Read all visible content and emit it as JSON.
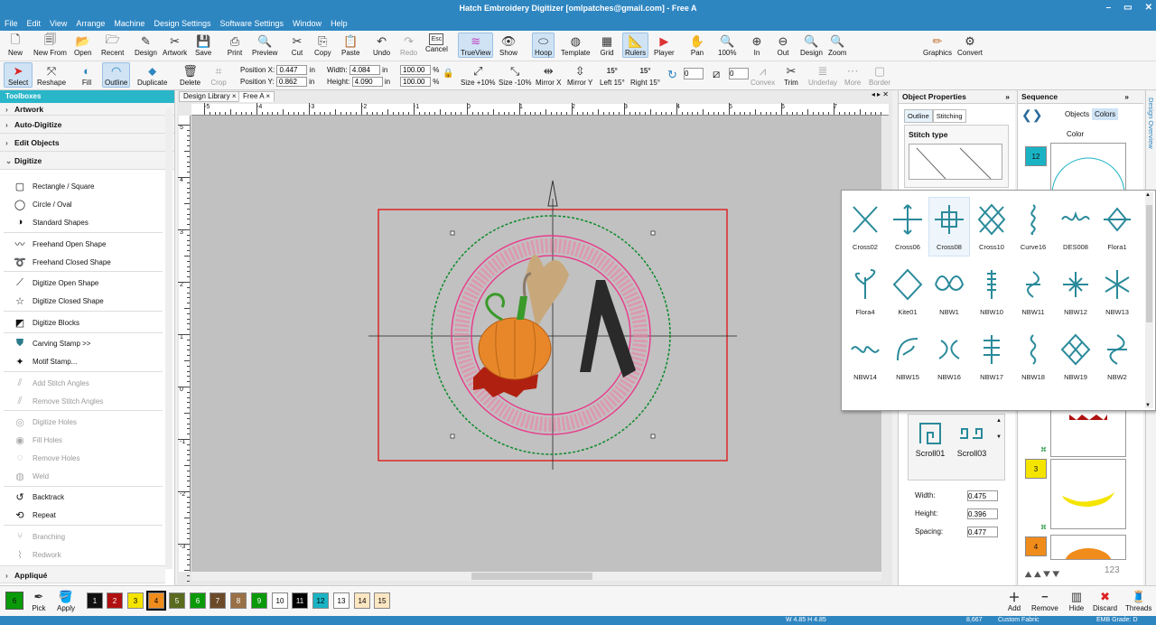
{
  "window": {
    "title": "Hatch Embroidery Digitizer [omlpatches@gmail.com] - Free A",
    "min": "–",
    "max": "▭",
    "close": "✕"
  },
  "menu": [
    "File",
    "Edit",
    "View",
    "Arrange",
    "Machine",
    "Design Settings",
    "Software Settings",
    "Window",
    "Help"
  ],
  "toolbar1": {
    "new": "New",
    "new_from": "New From",
    "open": "Open",
    "recent": "Recent",
    "design": "Design",
    "artwork": "Artwork",
    "save": "Save",
    "print": "Print",
    "preview": "Preview",
    "cut": "Cut",
    "copy": "Copy",
    "paste": "Paste",
    "undo": "Undo",
    "redo": "Redo",
    "cancel": "Cancel",
    "esc": "Esc",
    "trueview": "TrueView",
    "show": "Show",
    "hoop": "Hoop",
    "template": "Template",
    "grid": "Grid",
    "rulers": "Rulers",
    "player": "Player",
    "pan": "Pan",
    "zoom100": "100%",
    "in": "In",
    "out": "Out",
    "zdesign": "Design",
    "zoom": "Zoom",
    "zoom_value": "100",
    "percent": "%",
    "graphics": "Graphics",
    "convert": "Convert"
  },
  "toolbar2": {
    "select": "Select",
    "reshape": "Reshape",
    "fill": "Fill",
    "outline": "Outline",
    "duplicate": "Duplicate",
    "delete": "Delete",
    "crop": "Crop",
    "posx_label": "Position X:",
    "posx": "0.447",
    "posy_label": "Position Y:",
    "posy": "0.862",
    "unit": "in",
    "width_label": "Width:",
    "width": "4.084",
    "height_label": "Height:",
    "height": "4.090",
    "scale_w": "100.00",
    "scale_h": "100.00",
    "pct": "%",
    "size_up": "Size +10%",
    "size_down": "Size -10%",
    "mirror_x": "Mirror X",
    "mirror_y": "Mirror Y",
    "left15": "Left 15°",
    "right15": "Right 15°",
    "deg15": "15°",
    "rot_val": "0",
    "slant_val": "0",
    "convex": "Convex",
    "trim": "Trim",
    "underlay": "Underlay",
    "more": "More",
    "border": "Border"
  },
  "toolbox": {
    "title": "Toolboxes",
    "groups": [
      "Artwork",
      "Auto-Digitize",
      "Edit Objects",
      "Digitize",
      "Appliqué"
    ],
    "items": [
      "Rectangle / Square",
      "Circle / Oval",
      "Standard Shapes",
      "Freehand Open Shape",
      "Freehand Closed Shape",
      "Digitize Open Shape",
      "Digitize Closed Shape",
      "Digitize Blocks",
      "Carving Stamp >>",
      "Motif Stamp...",
      "Add Stitch Angles",
      "Remove Stitch Angles",
      "Digitize Holes",
      "Fill Holes",
      "Remove Holes",
      "Weld",
      "Backtrack",
      "Repeat",
      "Branching",
      "Redwork"
    ]
  },
  "tabs": {
    "library": "Design Library",
    "free_a": "Free A",
    "close": "×"
  },
  "ruler_labels": [
    "-5",
    "-4",
    "-3",
    "-2",
    "-1",
    "0",
    "1",
    "2",
    "3",
    "4",
    "5",
    "6",
    "7"
  ],
  "ruler_v_labels": [
    "5",
    "4",
    "3",
    "2",
    "1",
    "0",
    "-1",
    "-2",
    "-3"
  ],
  "objprops": {
    "title": "Object Properties",
    "tab_outline": "Outline",
    "tab_stitching": "Stitching",
    "stitch_type": "Stitch type",
    "scroll01": "Scroll01",
    "scroll03": "Scroll03",
    "width_label": "Width:",
    "width": "0.475",
    "height_label": "Height:",
    "height": "0.396",
    "spacing_label": "Spacing:",
    "spacing": "0.477"
  },
  "sequence": {
    "title": "Sequence",
    "objects": "Objects",
    "colors": "Colors",
    "color_hdr": "Color",
    "badges": [
      "12",
      "3",
      "4"
    ],
    "count": "123"
  },
  "sidetab": "Design Overview",
  "motifs": [
    [
      "Cross02",
      "Cross06",
      "Cross08",
      "Cross10",
      "Curve16",
      "DES008",
      "Flora1"
    ],
    [
      "Flora4",
      "Kite01",
      "NBW1",
      "NBW10",
      "NBW11",
      "NBW12",
      "NBW13"
    ],
    [
      "NBW14",
      "NBW15",
      "NBW16",
      "NBW17",
      "NBW18",
      "NBW19",
      "NBW2"
    ]
  ],
  "bottom": {
    "pick": "Pick",
    "apply": "Apply",
    "swatches": [
      {
        "n": "6",
        "c": "#0a9a0a",
        "fg": "#000"
      },
      {
        "n": "1",
        "c": "#111111",
        "fg": "#fff"
      },
      {
        "n": "2",
        "c": "#b01010",
        "fg": "#fff"
      },
      {
        "n": "3",
        "c": "#f5e400",
        "fg": "#000"
      },
      {
        "n": "4",
        "c": "#f08c1c",
        "fg": "#000"
      },
      {
        "n": "5",
        "c": "#5a6a1e",
        "fg": "#fff"
      },
      {
        "n": "6",
        "c": "#0a9a0a",
        "fg": "#fff"
      },
      {
        "n": "7",
        "c": "#6b4a2a",
        "fg": "#fff"
      },
      {
        "n": "8",
        "c": "#9a7046",
        "fg": "#fff"
      },
      {
        "n": "9",
        "c": "#0a9a0a",
        "fg": "#fff"
      },
      {
        "n": "10",
        "c": "#ffffff",
        "fg": "#000"
      },
      {
        "n": "11",
        "c": "#000000",
        "fg": "#fff"
      },
      {
        "n": "12",
        "c": "#1ab3c4",
        "fg": "#000"
      },
      {
        "n": "13",
        "c": "#ffffff",
        "fg": "#000"
      },
      {
        "n": "14",
        "c": "#fde6c2",
        "fg": "#000"
      },
      {
        "n": "15",
        "c": "#fde6c2",
        "fg": "#000"
      }
    ],
    "add": "Add",
    "remove": "Remove",
    "hide": "Hide",
    "discard": "Discard",
    "threads": "Threads"
  },
  "status": {
    "size": "W 4.85 H 4.85",
    "stitches": "8,667",
    "fabric": "Custom Fabric",
    "grade": "EMB Grade: D"
  },
  "colors": {
    "title": "#2e86c1",
    "accent": "#29b6c8",
    "frame": "#e01010",
    "hoop": "#0a8a2a",
    "pink": "#e83e8c"
  }
}
